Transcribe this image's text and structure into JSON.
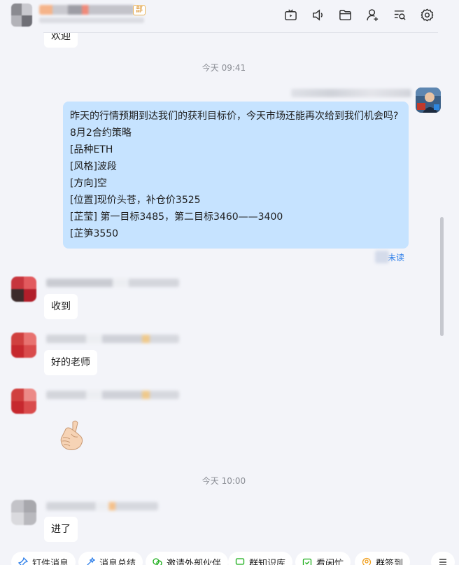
{
  "header": {
    "tag": "部",
    "icons": [
      "tv-icon",
      "speaker-icon",
      "folder-icon",
      "add-user-icon",
      "search-chat-icon",
      "gear-icon"
    ]
  },
  "messages": {
    "top_partial": "欢迎",
    "time1": "今天 09:41",
    "mine": {
      "lines": [
        "昨天的行情预期到达我们的获利目标价，今天市场还能再次给到我们机会吗?",
        "8月2合约策略",
        "[品种ETH",
        "[风格]波段",
        "[方向]空",
        "[位置]现价头苍，补仓价3525",
        "[芷莹] 第一目标3485，第二目标3460——3400",
        "[芷笋3550"
      ],
      "read_status": "未读"
    },
    "m1": "收到",
    "m2": "好的老师",
    "time2": "今天 10:00",
    "m4": "进了"
  },
  "toolbar": {
    "buttons": [
      "钉件消息",
      "消息总结",
      "邀请外部伙伴",
      "群知识库",
      "看闲忙",
      "群签到"
    ],
    "more_icon": "menu-icon"
  },
  "colors": {
    "background": "#f3f4f9",
    "mine_bubble": "#c6e3ff",
    "link": "#2b7de9"
  }
}
